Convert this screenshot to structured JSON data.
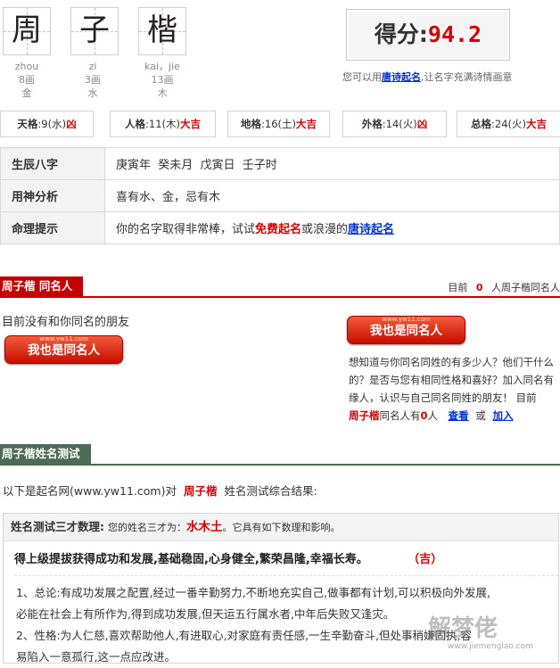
{
  "name_chars": [
    {
      "char": "周",
      "pinyin": "zhou",
      "strokes": "8画",
      "element": "金"
    },
    {
      "char": "子",
      "pinyin": "zi",
      "strokes": "3画",
      "element": "水"
    },
    {
      "char": "楷",
      "pinyin": "kai，jie",
      "strokes": "13画",
      "element": "木"
    }
  ],
  "score": {
    "label": "得分:",
    "value": "94.2"
  },
  "hint": {
    "prefix": "您可以用",
    "link": "唐诗起名",
    "suffix": ",让名字充满诗情画意"
  },
  "wuge": [
    {
      "name": "天格",
      "value": ":9(水)",
      "luck": "凶"
    },
    {
      "name": "人格",
      "value": ":11(木)",
      "luck": "大吉"
    },
    {
      "name": "地格",
      "value": ":16(土)",
      "luck": "大吉"
    },
    {
      "name": "外格",
      "value": ":14(火)",
      "luck": "凶"
    },
    {
      "name": "总格",
      "value": ":24(火)",
      "luck": "大吉"
    }
  ],
  "info_rows": {
    "bazi": {
      "label": "生辰八字",
      "value": "庚寅年  癸未月  戊寅日  壬子时"
    },
    "yongshen": {
      "label": "用神分析",
      "value": "喜有水、金，忌有木"
    },
    "tip": {
      "label": "命理提示",
      "prefix": "你的名字取得非常棒，试试",
      "link1": "免费起名",
      "middle": "或浪漫的",
      "link2": "唐诗起名"
    }
  },
  "same_name": {
    "tab": "周子楷 同名人",
    "count_prefix": "目前",
    "count": "0",
    "count_suffix": "人周子楷同名人",
    "none_text": "目前没有和你同名的朋友",
    "button_label": "我也是同名人",
    "button_watermark": "www.yw11.com",
    "desc_line1": "想知道与你同名同姓的有多少人？他们干什么",
    "desc_line2": "的？是否与您有相同性格和喜好？加入同名有",
    "desc_line3": "缘人，认识与自己同名同姓的朋友！  目前",
    "footer_name": "周子楷",
    "footer_mid": "同名人有",
    "footer_count": "0",
    "footer_unit": "人",
    "link_view": "查看",
    "or": "或",
    "link_join": "加入"
  },
  "test": {
    "tab": "周子楷姓名测试",
    "intro_prefix": "以下是起名网(www.yw11.com)对",
    "intro_name": "周子楷",
    "intro_suffix": "姓名测试综合结果:",
    "sancai_title": "姓名测试三才数理:",
    "sancai_pre": "您的姓名三才为：",
    "sancai_value": "水木土",
    "sancai_post": "。它具有如下数理和影响。",
    "summary": "得上级提拔获得成功和发展,基础稳固,心身健全,繁荣昌隆,幸福长寿。",
    "summary_luck": "（吉）",
    "line1": "1、总论:有成功发展之配置,经过一番辛勤努力,不断地充实自己,做事都有计划,可以积极向外发展,",
    "line2": "必能在社会上有所作为,得到成功发展,但天运五行属水者,中年后失败又逢灾。",
    "line3": "2、性格:为人仁慈,喜欢帮助他人,有进取心,对家庭有责任感,一生辛勤奋斗,但处事稍嫌固执,容",
    "line4": "易陷入一意孤行,这一点应改进。"
  },
  "watermark": {
    "big": "解梦佬",
    "url": "www.jiemenglao.com"
  },
  "colors": {
    "accent_red": "#d40000",
    "link_blue": "#0033cc",
    "tab_green": "#4e6b56"
  }
}
